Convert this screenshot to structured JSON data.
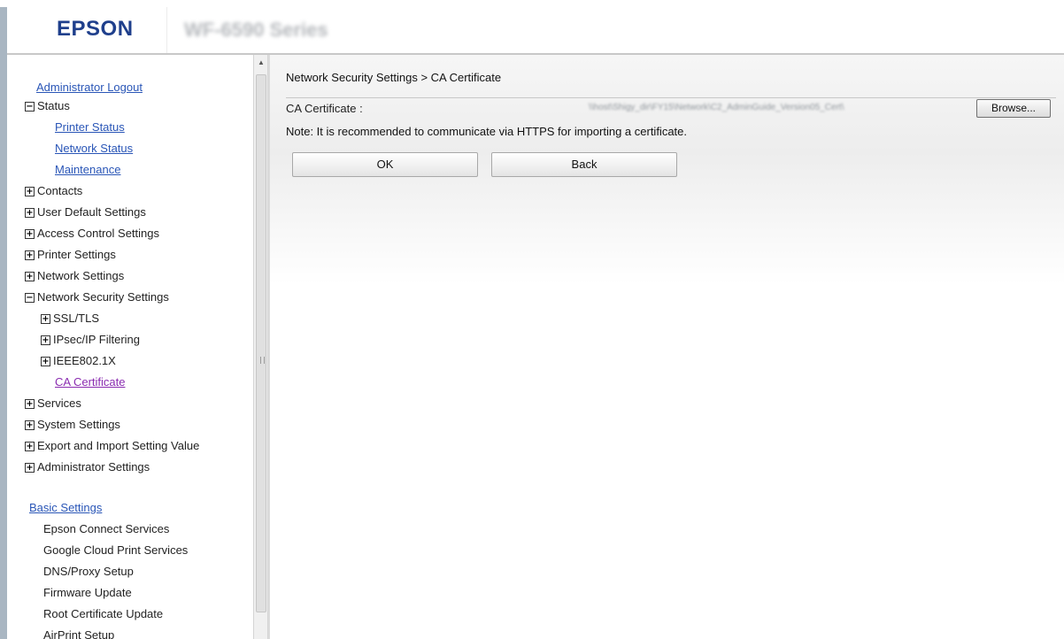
{
  "header": {
    "logo": "EPSON",
    "model": "WF-6590 Series"
  },
  "sidebar": {
    "admin_logout": "Administrator Logout",
    "status": "Status",
    "printer_status": "Printer Status",
    "network_status": "Network Status",
    "maintenance": "Maintenance",
    "contacts": "Contacts",
    "user_default_settings": "User Default Settings",
    "access_control_settings": "Access Control Settings",
    "printer_settings": "Printer Settings",
    "network_settings": "Network Settings",
    "network_security_settings": "Network Security Settings",
    "ssl_tls": "SSL/TLS",
    "ipsec": "IPsec/IP Filtering",
    "ieee8021x": "IEEE802.1X",
    "ca_certificate": "CA Certificate",
    "services": "Services",
    "system_settings": "System Settings",
    "export_import": "Export and Import Setting Value",
    "administrator_settings": "Administrator Settings",
    "basic_settings": "Basic Settings",
    "epson_connect": "Epson Connect Services",
    "google_cloud": "Google Cloud Print Services",
    "dns_proxy": "DNS/Proxy Setup",
    "firmware_update": "Firmware Update",
    "root_cert_update": "Root Certificate Update",
    "airprint": "AirPrint Setup",
    "toggle_plus": "+",
    "toggle_minus": "−"
  },
  "main": {
    "breadcrumb": "Network Security Settings > CA Certificate",
    "ca_cert_label": "CA Certificate :",
    "file_path": "\\\\host\\Shigy_dir\\FY15\\Network\\C2_AdminGuide_Version05_Cert\\",
    "browse_label": "Browse...",
    "note": "Note: It is recommended to communicate via HTTPS for importing a certificate.",
    "ok_label": "OK",
    "back_label": "Back"
  },
  "colors": {
    "brand": "#1f3f8c",
    "link": "#2a56b7",
    "visited_link": "#8a2bb0"
  }
}
